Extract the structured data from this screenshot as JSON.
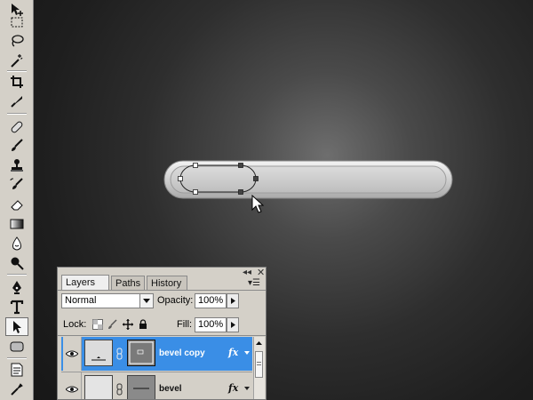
{
  "tools": [
    {
      "name": "move-tool-icon"
    },
    {
      "name": "marquee-tool-icon"
    },
    {
      "name": "lasso-tool-icon"
    },
    {
      "name": "magic-wand-tool-icon"
    },
    {
      "name": "crop-tool-icon"
    },
    {
      "name": "slice-tool-icon"
    },
    {
      "name": "healing-brush-tool-icon"
    },
    {
      "name": "brush-tool-icon"
    },
    {
      "name": "clone-stamp-tool-icon"
    },
    {
      "name": "history-brush-tool-icon"
    },
    {
      "name": "eraser-tool-icon"
    },
    {
      "name": "gradient-tool-icon"
    },
    {
      "name": "blur-tool-icon"
    },
    {
      "name": "dodge-tool-icon"
    },
    {
      "name": "pen-tool-icon"
    },
    {
      "name": "type-tool-icon"
    },
    {
      "name": "path-selection-tool-icon"
    },
    {
      "name": "shape-tool-icon"
    },
    {
      "name": "notes-tool-icon"
    },
    {
      "name": "eyedropper-tool-icon"
    }
  ],
  "panel": {
    "tabs": [
      {
        "label": "Layers",
        "active": true
      },
      {
        "label": "Paths",
        "active": false
      },
      {
        "label": "History",
        "active": false
      }
    ],
    "tab_close": "×",
    "blend_mode": "Normal",
    "opacity_label": "Opacity:",
    "opacity_value": "100%",
    "lock_label": "Lock:",
    "fill_label": "Fill:",
    "fill_value": "100%",
    "layers": [
      {
        "name": "bevel copy",
        "selected": true,
        "fx": "fx"
      },
      {
        "name": "bevel",
        "selected": false,
        "fx": "fx"
      }
    ]
  },
  "colors": {
    "accent": "#3a8ee6",
    "panel_bg": "#d4d0c8"
  }
}
